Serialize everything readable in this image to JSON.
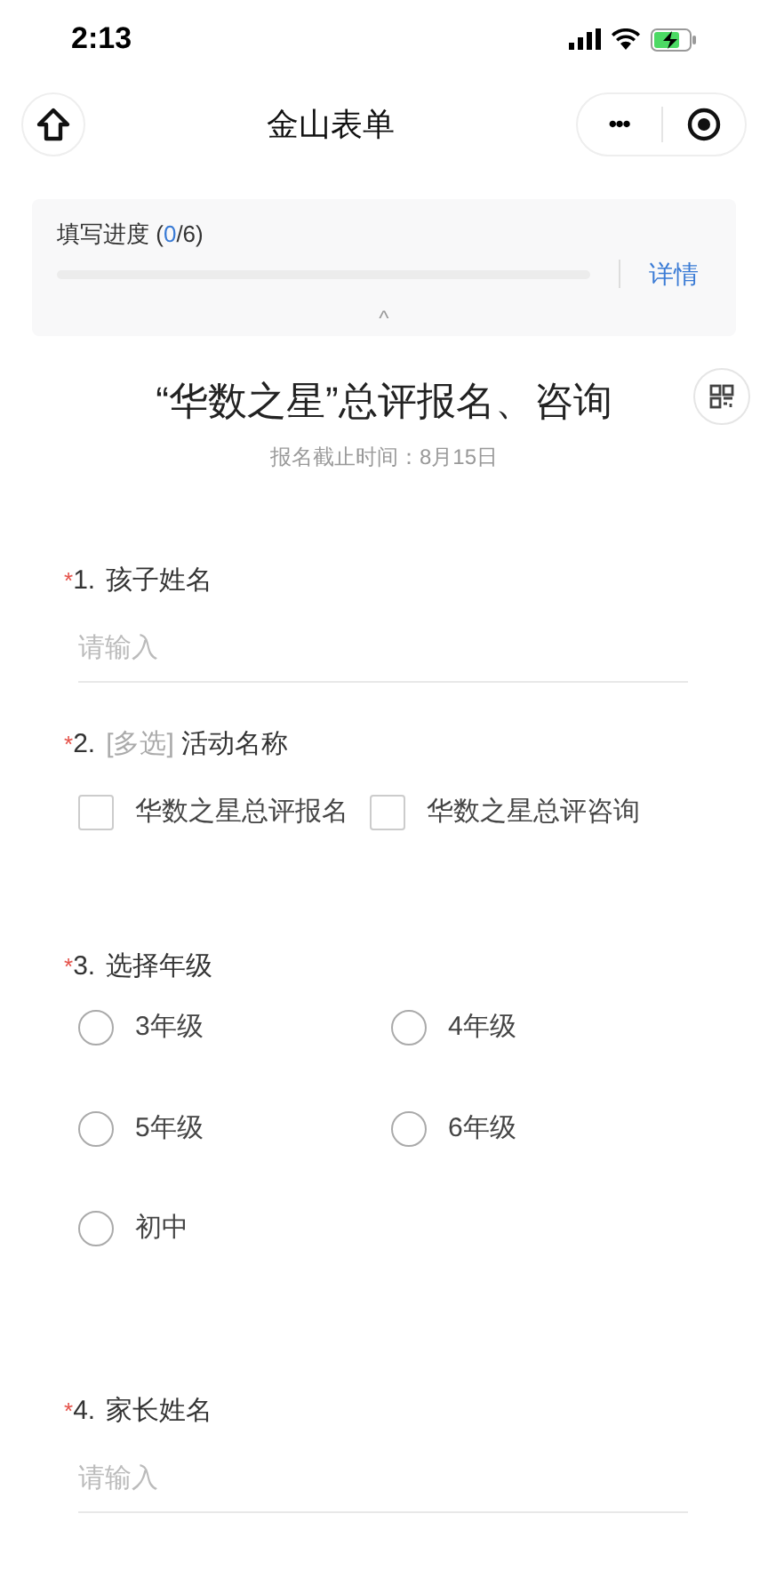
{
  "status_bar": {
    "time": "2:13"
  },
  "nav": {
    "title": "金山表单",
    "more": "•••"
  },
  "progress": {
    "label_start": "填写进度 (",
    "count": "0",
    "label_end": "/6)",
    "level": 0,
    "details": "详情",
    "collapse": "^"
  },
  "form": {
    "title": "“华数之星”总评报名、咨询",
    "deadline": "报名截止时间：8月15日"
  },
  "questions": [
    {
      "kind": "text",
      "required": "*",
      "number": "1.",
      "title": "孩子姓名",
      "placeholder": "请输入"
    },
    {
      "kind": "checkbox",
      "required": "*",
      "number": "2.",
      "tag": "[多选]",
      "title": "活动名称",
      "options": [
        {
          "label": "华数之星总评报名",
          "checked": false
        },
        {
          "label": "华数之星总评咨询",
          "checked": false
        }
      ]
    },
    {
      "kind": "radio",
      "required": "*",
      "number": "3.",
      "title": "选择年级",
      "options": [
        {
          "label": "3年级",
          "selected": false
        },
        {
          "label": "4年级",
          "selected": false
        },
        {
          "label": "5年级",
          "selected": false
        },
        {
          "label": "6年级",
          "selected": false
        },
        {
          "label": "初中",
          "selected": false
        }
      ]
    },
    {
      "kind": "text",
      "required": "*",
      "number": "4.",
      "title": "家长姓名",
      "placeholder": "请输入"
    }
  ]
}
